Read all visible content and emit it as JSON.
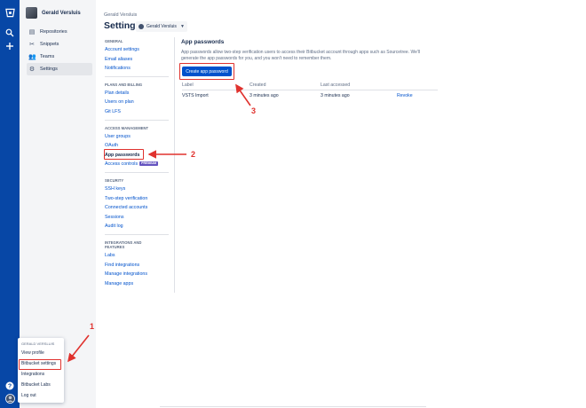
{
  "colors": {
    "rail": "#0747a6",
    "accent": "#0052cc",
    "annotation": "#e0322e",
    "premium": "#6554c0"
  },
  "rail": {
    "logo_icon": "bitbucket-logo-icon",
    "search_icon": "search-icon",
    "create_icon": "plus-icon",
    "help_icon": "question-icon",
    "avatar_icon": "avatar-icon"
  },
  "sidebar": {
    "user_name": "Gerald Versluis",
    "items": [
      {
        "label": "Repositories",
        "icon": "repositories-icon",
        "active": false
      },
      {
        "label": "Snippets",
        "icon": "snippets-icon",
        "active": false
      },
      {
        "label": "Teams",
        "icon": "teams-icon",
        "active": false
      },
      {
        "label": "Settings",
        "icon": "gear-icon",
        "active": true
      }
    ]
  },
  "header": {
    "owner": "Gerald Versluis",
    "title": "Settings",
    "account_selector": "Gerald Versluis"
  },
  "settings_nav": {
    "general": {
      "title": "GENERAL",
      "items": [
        "Account settings",
        "Email aliases",
        "Notifications"
      ]
    },
    "plans": {
      "title": "PLANS AND BILLING",
      "items": [
        "Plan details",
        "Users on plan",
        "Git LFS"
      ]
    },
    "access": {
      "title": "ACCESS MANAGEMENT",
      "items": [
        "User groups",
        "OAuth",
        "App passwords",
        "Access controls"
      ],
      "premium": "PREMIUM"
    },
    "security": {
      "title": "SECURITY",
      "items": [
        "SSH keys",
        "Two-step verification",
        "Connected accounts",
        "Sessions",
        "Audit log"
      ]
    },
    "integrations": {
      "title": "INTEGRATIONS AND FEATURES",
      "items": [
        "Labs",
        "Find integrations",
        "Manage integrations",
        "Manage apps"
      ]
    }
  },
  "main": {
    "heading": "App passwords",
    "description": "App passwords allow two-step verification users to access their Bitbucket account through apps such as Sourcetree. We'll generate the app passwords for you, and you won't need to remember them.",
    "create_button": "Create app password",
    "table": {
      "headers": [
        "Label",
        "Created",
        "Last accessed",
        ""
      ],
      "rows": [
        {
          "label": "VSTS Import",
          "created": "3 minutes ago",
          "last_accessed": "3 minutes ago",
          "action": "Revoke"
        }
      ]
    }
  },
  "annotations": {
    "one": "1",
    "two": "2",
    "three": "3"
  },
  "profile_menu": {
    "header": "GERALD VERSLUIS",
    "items": [
      "View profile",
      "Bitbucket settings",
      "Integrations",
      "Bitbucket Labs",
      "Log out"
    ]
  }
}
